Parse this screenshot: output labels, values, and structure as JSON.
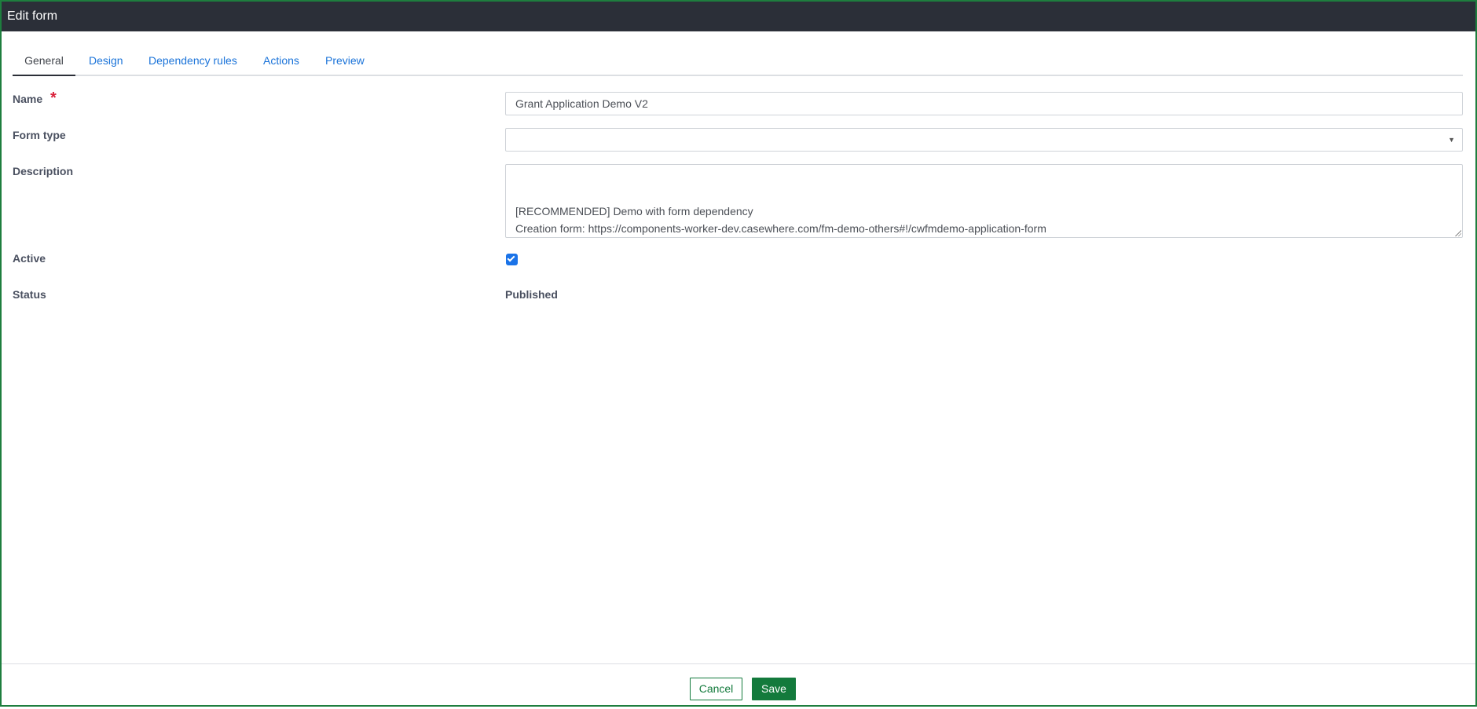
{
  "window": {
    "title": "Edit form"
  },
  "tabs": [
    {
      "label": "General",
      "active": true
    },
    {
      "label": "Design",
      "active": false
    },
    {
      "label": "Dependency rules",
      "active": false
    },
    {
      "label": "Actions",
      "active": false
    },
    {
      "label": "Preview",
      "active": false
    }
  ],
  "form": {
    "name": {
      "label": "Name",
      "required_mark": "*",
      "value": "Grant Application Demo V2"
    },
    "form_type": {
      "label": "Form type",
      "value": ""
    },
    "description": {
      "label": "Description",
      "value": "[RECOMMENDED] Demo with form dependency\nCreation form: https://components-worker-dev.casewhere.com/fm-demo-others#!/cwfmdemo-application-form\nEdit/View Form: https://components-worker-dev.casewhere.com/form-management#!/cw-form-management-demo-grant-application-demo"
    },
    "active": {
      "label": "Active",
      "checked": true
    },
    "status": {
      "label": "Status",
      "value": "Published"
    }
  },
  "footer": {
    "cancel_label": "Cancel",
    "save_label": "Save"
  },
  "icons": {
    "select_arrow": "chevron-down-icon",
    "checkbox_mark": "check-icon"
  },
  "colors": {
    "accent": "#137a3c",
    "link": "#1a73d9",
    "titlebar": "#2b2f38",
    "required": "#d9203a",
    "checkbox": "#1a73e8"
  }
}
